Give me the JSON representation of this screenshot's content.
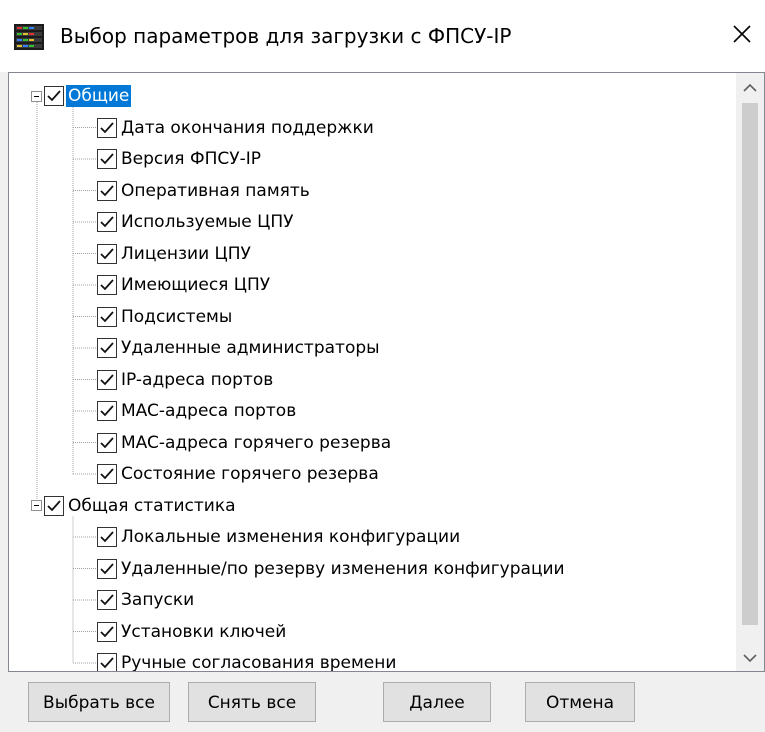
{
  "window": {
    "title": "Выбор параметров для загрузки с ФПСУ-IP",
    "icon": "server-rack-icon",
    "close_icon": "close-icon"
  },
  "colors": {
    "selection": "#0078d7",
    "panel_border": "#828790",
    "button_face": "#e1e1e1"
  },
  "tree": {
    "groups": [
      {
        "label": "Общие",
        "checked": true,
        "expanded": true,
        "selected": true,
        "items": [
          {
            "label": "Дата окончания поддержки",
            "checked": true
          },
          {
            "label": "Версия ФПСУ-IP",
            "checked": true
          },
          {
            "label": "Оперативная память",
            "checked": true
          },
          {
            "label": "Используемые ЦПУ",
            "checked": true
          },
          {
            "label": "Лицензии ЦПУ",
            "checked": true
          },
          {
            "label": "Имеющиеся ЦПУ",
            "checked": true
          },
          {
            "label": "Подсистемы",
            "checked": true
          },
          {
            "label": "Удаленные администраторы",
            "checked": true
          },
          {
            "label": "IP-адреса портов",
            "checked": true
          },
          {
            "label": "MAC-адреса портов",
            "checked": true
          },
          {
            "label": "MAC-адреса горячего резерва",
            "checked": true
          },
          {
            "label": "Состояние горячего резерва",
            "checked": true
          }
        ]
      },
      {
        "label": "Общая статистика",
        "checked": true,
        "expanded": true,
        "selected": false,
        "items": [
          {
            "label": "Локальные изменения конфигурации",
            "checked": true
          },
          {
            "label": "Удаленные/по резерву изменения конфигурации",
            "checked": true
          },
          {
            "label": "Запуски",
            "checked": true
          },
          {
            "label": "Установки ключей",
            "checked": true
          },
          {
            "label": "Ручные согласования времени",
            "checked": true
          }
        ]
      }
    ]
  },
  "buttons": {
    "select_all": "Выбрать все",
    "clear_all": "Снять все",
    "next": "Далее",
    "cancel": "Отмена"
  }
}
